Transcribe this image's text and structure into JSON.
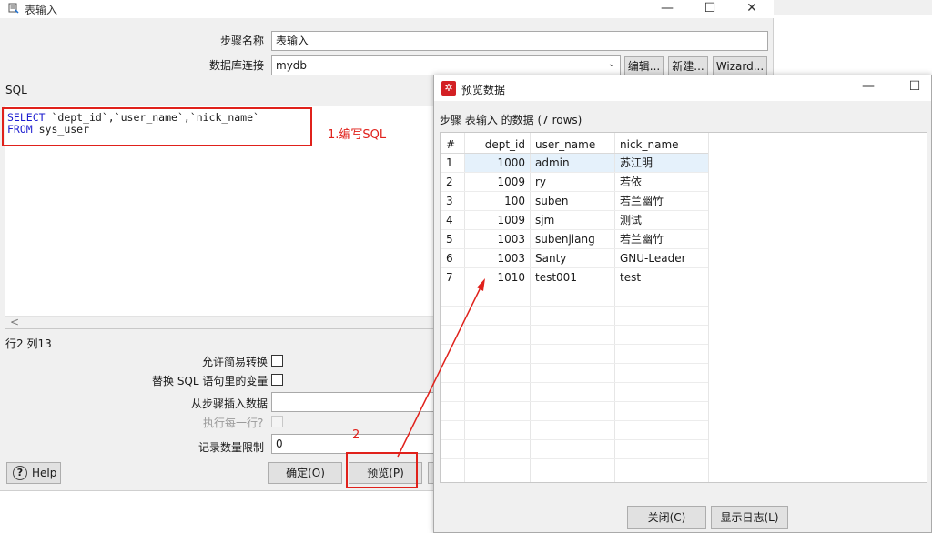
{
  "main_dialog": {
    "title": "表输入",
    "step_name_label": "步骤名称",
    "step_name_value": "表输入",
    "db_conn_label": "数据库连接",
    "db_conn_value": "mydb",
    "edit_button": "编辑...",
    "new_button": "新建...",
    "wizard_button": "Wizard...",
    "sql_label": "SQL",
    "sql_line1_kw": "SELECT",
    "sql_line1_rest": " `dept_id`,`user_name`,`nick_name`",
    "sql_line2_kw": "FROM",
    "sql_line2_rest": " sys_user",
    "scroll_left": "<",
    "cursor_pos": "行2 列13",
    "lazy_conv_label": "允许简易转换",
    "replace_vars_label": "替换 SQL 语句里的变量",
    "insert_from_step_label": "从步骤插入数据",
    "exec_each_row_label": "执行每一行?",
    "limit_label": "记录数量限制",
    "limit_value": "0",
    "help_button": "Help",
    "ok_button": "确定(O)",
    "preview_button": "预览(P)"
  },
  "annotations": {
    "step1": "1.编写SQL",
    "step2": "2"
  },
  "preview_dialog": {
    "title": "预览数据",
    "subtitle": "步骤 表输入 的数据  (7 rows)",
    "columns": [
      "#",
      "dept_id",
      "user_name",
      "nick_name"
    ],
    "rows": [
      [
        "1",
        "1000",
        "admin",
        "苏江明"
      ],
      [
        "2",
        "1009",
        "ry",
        "若依"
      ],
      [
        "3",
        "100",
        "suben",
        "若兰幽竹"
      ],
      [
        "4",
        "1009",
        "sjm",
        "测试"
      ],
      [
        "5",
        "1003",
        "subenjiang",
        "若兰幽竹"
      ],
      [
        "6",
        "1003",
        "Santy",
        "GNU-Leader"
      ],
      [
        "7",
        "1010",
        "test001",
        "test"
      ]
    ],
    "close_button": "关闭(C)",
    "show_log_button": "显示日志(L)"
  },
  "colors": {
    "accent_red": "#e0211b",
    "sql_keyword": "#1c1ccf",
    "selected_row": "#e5f1fb"
  }
}
